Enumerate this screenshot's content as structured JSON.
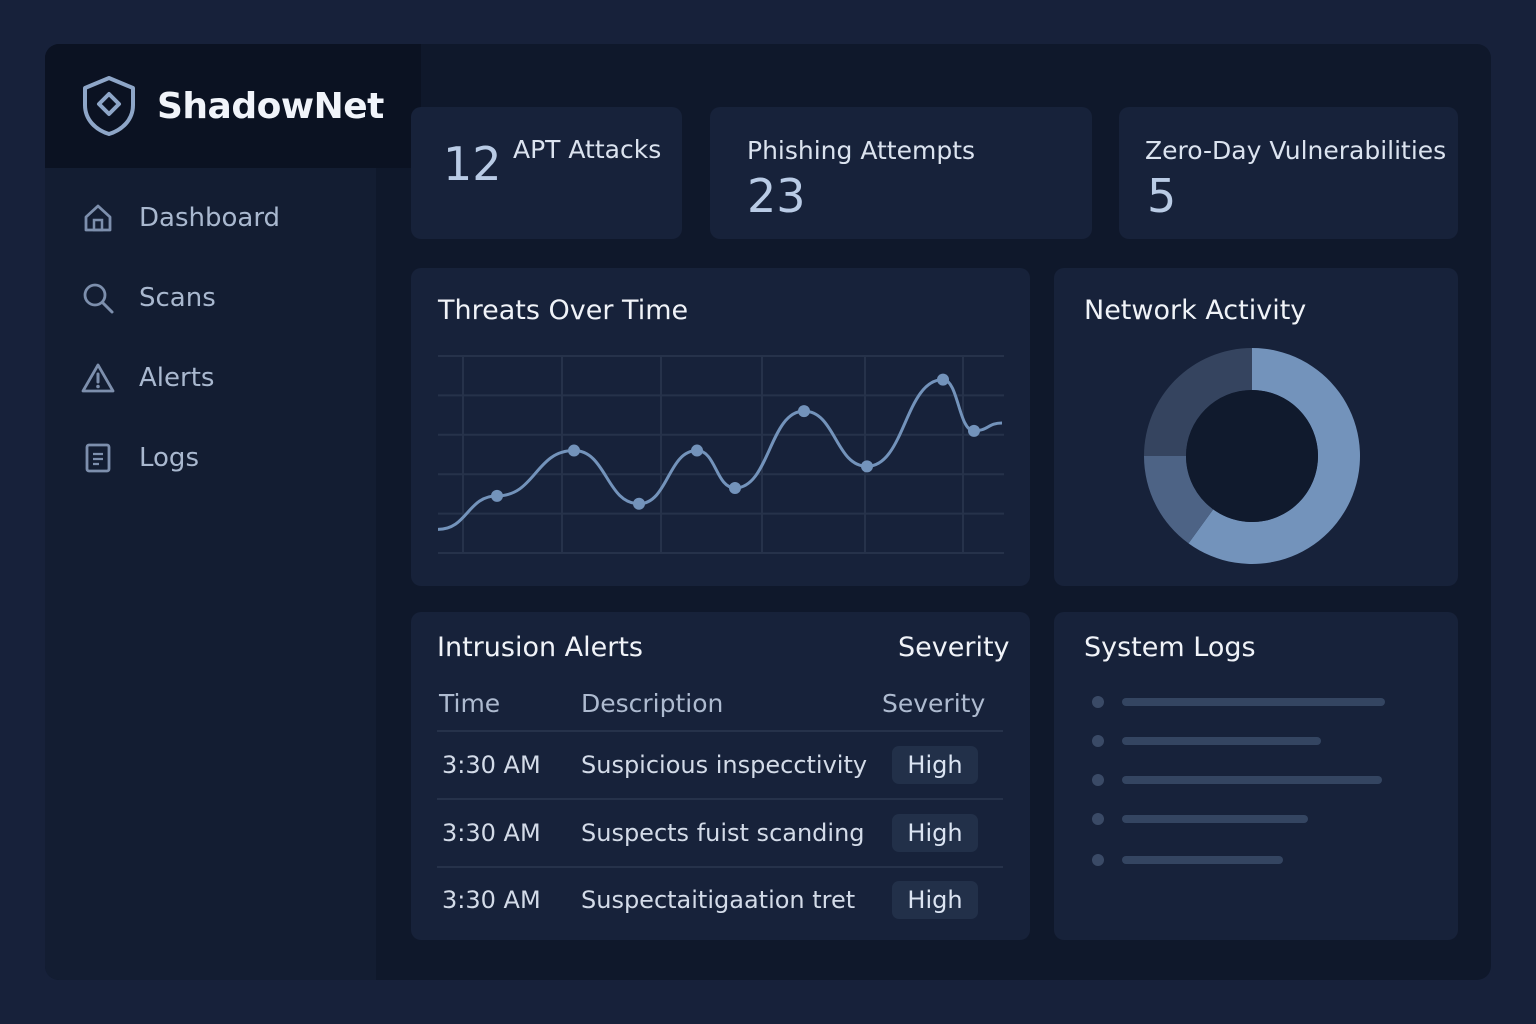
{
  "app": {
    "name": "ShadowNet"
  },
  "sidebar": {
    "items": [
      {
        "label": "Dashboard",
        "icon": "home-icon"
      },
      {
        "label": "Scans",
        "icon": "search-icon"
      },
      {
        "label": "Alerts",
        "icon": "warning-icon"
      },
      {
        "label": "Logs",
        "icon": "document-icon"
      }
    ]
  },
  "stats": {
    "apt": {
      "value": "12",
      "label": "APT Attacks"
    },
    "phishing": {
      "value": "23",
      "label": "Phishing Attempts"
    },
    "zeroday": {
      "value": "5",
      "label": "Zero-Day Vulnerabilities"
    }
  },
  "threats": {
    "title": "Threats Over Time",
    "points": [
      0.12,
      0.29,
      0.52,
      0.25,
      0.52,
      0.33,
      0.72,
      0.44,
      0.88,
      0.62,
      0.66
    ]
  },
  "network": {
    "title": "Network Activity",
    "segments": [
      {
        "value": 0.6,
        "color": "#7393bb"
      },
      {
        "value": 0.15,
        "color": "#4d6385"
      },
      {
        "value": 0.25,
        "color": "#35445f"
      }
    ]
  },
  "alerts": {
    "title": "Intrusion Alerts",
    "header_severity": "Severity",
    "columns": [
      "Time",
      "Description",
      "Severity"
    ],
    "rows": [
      {
        "time": "3:30 AM",
        "description": "Suspicious inspecctivity",
        "severity": "High"
      },
      {
        "time": "3:30 AM",
        "description": "Suspects fuist scanding",
        "severity": "High"
      },
      {
        "time": "3:30 AM",
        "description": "Suspectaitigaation tret",
        "severity": "High"
      }
    ]
  },
  "logs": {
    "title": "System Logs",
    "line_count": 5
  },
  "colors": {
    "background": "#17213a",
    "panel": "#17223a",
    "accent": "#7393bb"
  }
}
